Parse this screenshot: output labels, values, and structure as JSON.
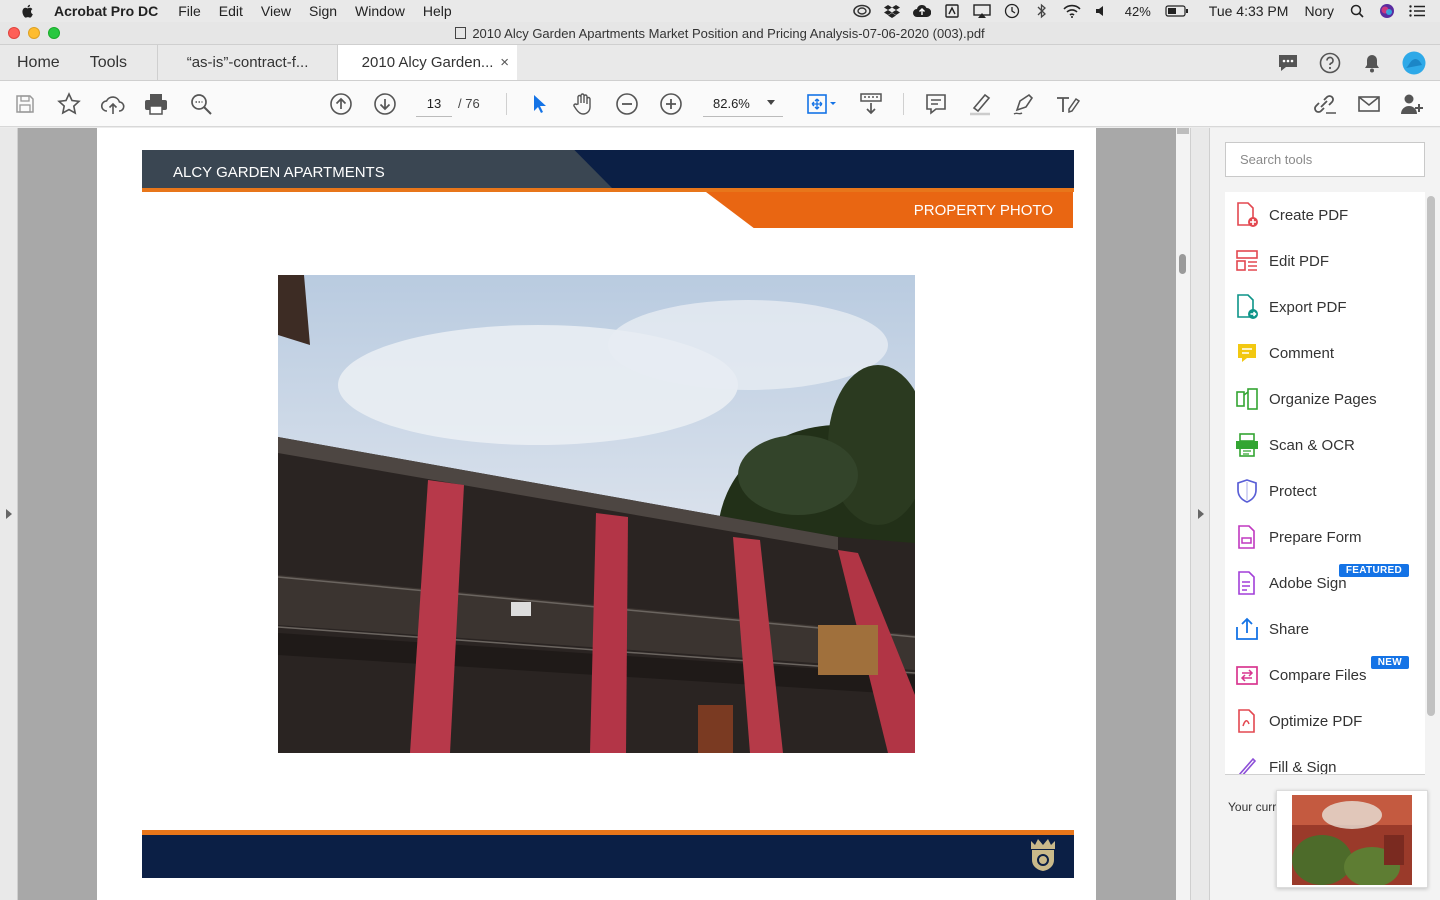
{
  "menubar": {
    "app_name": "Acrobat Pro DC",
    "menus": [
      "File",
      "Edit",
      "View",
      "Sign",
      "Window",
      "Help"
    ],
    "battery": "42%",
    "clock": "Tue 4:33 PM",
    "user": "Nory"
  },
  "window": {
    "title": "2010 Alcy Garden Apartments Market Position and Pricing Analysis-07-06-2020 (003).pdf"
  },
  "tabs": {
    "home": "Home",
    "tools": "Tools",
    "doc1": "“as-is”-contract-f...",
    "doc2": "2010 Alcy Garden...",
    "close": "×"
  },
  "toolbar": {
    "current_page": "13",
    "total_pages": "/ 76",
    "zoom": "82.6%"
  },
  "document": {
    "header_title": "ALCY GARDEN APARTMENTS",
    "section_label": "PROPERTY PHOTO"
  },
  "tools_pane": {
    "search_placeholder": "Search tools",
    "items": [
      {
        "label": "Create PDF",
        "icon": "create-pdf-icon",
        "color": "#e34850"
      },
      {
        "label": "Edit PDF",
        "icon": "edit-pdf-icon",
        "color": "#e34850"
      },
      {
        "label": "Export PDF",
        "icon": "export-pdf-icon",
        "color": "#0d9488"
      },
      {
        "label": "Comment",
        "icon": "comment-icon",
        "color": "#e6b800"
      },
      {
        "label": "Organize Pages",
        "icon": "organize-pages-icon",
        "color": "#33a532"
      },
      {
        "label": "Scan & OCR",
        "icon": "scan-ocr-icon",
        "color": "#33a532"
      },
      {
        "label": "Protect",
        "icon": "protect-icon",
        "color": "#5a5fd6"
      },
      {
        "label": "Prepare Form",
        "icon": "prepare-form-icon",
        "color": "#c038c0"
      },
      {
        "label": "Adobe Sign",
        "icon": "adobe-sign-icon",
        "color": "#a23fd8",
        "badge": "FEATURED"
      },
      {
        "label": "Share",
        "icon": "share-icon",
        "color": "#1473e6"
      },
      {
        "label": "Compare Files",
        "icon": "compare-files-icon",
        "color": "#d83790",
        "badge": "NEW"
      },
      {
        "label": "Optimize PDF",
        "icon": "optimize-pdf-icon",
        "color": "#e34850"
      },
      {
        "label": "Fill & Sign",
        "icon": "fill-sign-icon",
        "color": "#8d4fd8"
      }
    ],
    "your_current": "Your curr"
  }
}
